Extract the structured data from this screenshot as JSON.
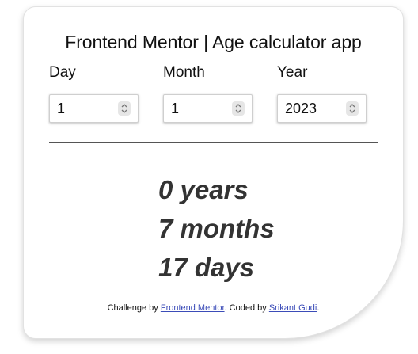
{
  "title": "Frontend Mentor | Age calculator app",
  "inputs": {
    "day": {
      "label": "Day",
      "value": "1"
    },
    "month": {
      "label": "Month",
      "value": "1"
    },
    "year": {
      "label": "Year",
      "value": "2023"
    }
  },
  "results": {
    "years": "0 years",
    "months": "7 months",
    "days": "17 days"
  },
  "footer": {
    "prefix": "Challenge by ",
    "challenge_link": "Frontend Mentor",
    "middle": ". Coded by ",
    "author_link": "Srikant Gudi",
    "suffix": "."
  },
  "icons": {
    "spinner": "chevron-up-down-icon"
  }
}
